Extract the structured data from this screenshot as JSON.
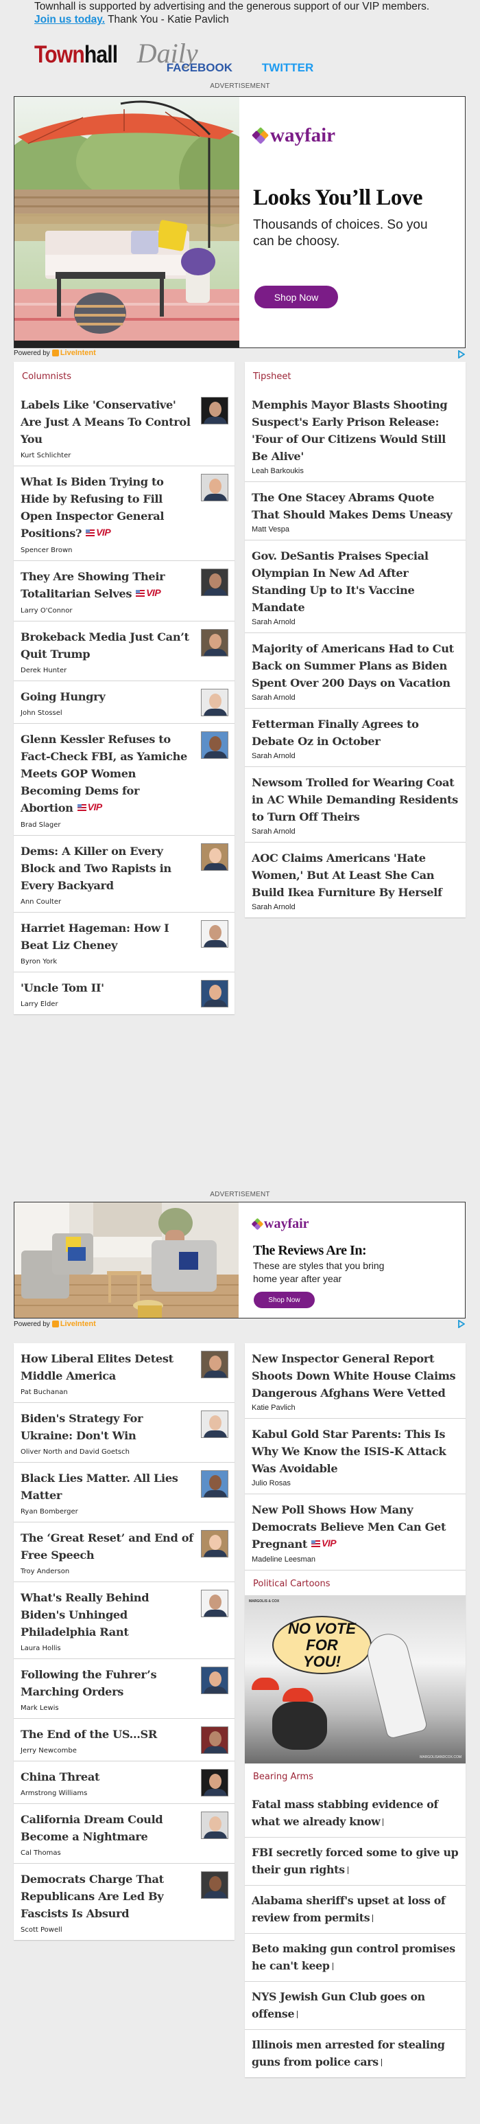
{
  "header": {
    "support_text": "Townhall is supported by advertising and the generous support of our VIP members.",
    "join_link": "Join us today.",
    "thanks_text": " Thank You - Katie Pavlich",
    "logo_town": "Town",
    "logo_hall": "hall",
    "logo_daily": "Daily",
    "social": {
      "facebook": "FACEBOOK",
      "twitter": "TWITTER"
    }
  },
  "ads": [
    {
      "label": "ADVERTISEMENT",
      "brand": "wayfair",
      "headline": "Looks You’ll Love",
      "subtext": "Thousands of choices. So you can be choosy.",
      "cta": "Shop Now",
      "powered_by": "Powered by",
      "powered_brand": "LiveIntent"
    },
    {
      "label": "ADVERTISEMENT",
      "brand": "wayfair",
      "headline": "The Reviews Are In:",
      "subtext": "These are styles that you bring home year after year",
      "cta": "Shop Now",
      "powered_by": "Powered by",
      "powered_brand": "LiveIntent"
    }
  ],
  "vip_label": "VIP",
  "columnists": {
    "title": "Columnists",
    "items": [
      {
        "headline": "Labels Like 'Conservative' Are Just A Means To Control You",
        "author": "Kurt Schlichter",
        "vip": false
      },
      {
        "headline": "What Is Biden Trying to Hide by Refusing to Fill Open Inspector General Positions?",
        "author": "Spencer Brown",
        "vip": true
      },
      {
        "headline": "They Are Showing Their Totalitarian Selves",
        "author": "Larry O'Connor",
        "vip": true
      },
      {
        "headline": "Brokeback Media Just Can’t Quit Trump",
        "author": "Derek Hunter",
        "vip": false
      },
      {
        "headline": "Going Hungry",
        "author": "John Stossel",
        "vip": false
      },
      {
        "headline": "Glenn Kessler Refuses to Fact-Check FBI, as Yamiche Meets GOP Women Becoming Dems for Abortion",
        "author": "Brad Slager",
        "vip": true
      },
      {
        "headline": "Dems: A Killer on Every Block and Two Rapists in Every Backyard",
        "author": "Ann Coulter",
        "vip": false
      },
      {
        "headline": "Harriet Hageman: How I Beat Liz Cheney",
        "author": "Byron York",
        "vip": false
      },
      {
        "headline": "'Uncle Tom II'",
        "author": "Larry Elder",
        "vip": false
      }
    ]
  },
  "tipsheet": {
    "title": "Tipsheet",
    "items": [
      {
        "headline": "Memphis Mayor Blasts Shooting Suspect's Early Prison Release: 'Four of Our Citizens Would Still Be Alive'",
        "author": "Leah Barkoukis"
      },
      {
        "headline": "The One Stacey Abrams Quote That Should Makes Dems Uneasy",
        "author": "Matt Vespa"
      },
      {
        "headline": "Gov. DeSantis Praises Special Olympian In New Ad After Standing Up to It's Vaccine Mandate",
        "author": "Sarah Arnold"
      },
      {
        "headline": "Majority of Americans Had to Cut Back on Summer Plans as Biden Spent Over 200 Days on Vacation",
        "author": "Sarah Arnold"
      },
      {
        "headline": "Fetterman Finally Agrees to Debate Oz in October",
        "author": "Sarah Arnold"
      },
      {
        "headline": "Newsom Trolled for Wearing Coat in AC While Demanding Residents to Turn Off Theirs",
        "author": "Sarah Arnold"
      },
      {
        "headline": "AOC Claims Americans 'Hate Women,' But At Least She Can Build Ikea Furniture By Herself",
        "author": "Sarah Arnold"
      }
    ]
  },
  "columnists2": {
    "items": [
      {
        "headline": "How Liberal Elites Detest Middle America",
        "author": "Pat Buchanan"
      },
      {
        "headline": "Biden's Strategy For Ukraine: Don't Win",
        "author": "Oliver North and David Goetsch"
      },
      {
        "headline": "Black Lies Matter. All Lies Matter",
        "author": "Ryan Bomberger"
      },
      {
        "headline": "The ‘Great Reset’ and End of Free Speech",
        "author": "Troy Anderson"
      },
      {
        "headline": "What's Really Behind Biden's Unhinged Philadelphia Rant",
        "author": "Laura Hollis"
      },
      {
        "headline": "Following the Fuhrer’s Marching Orders",
        "author": "Mark Lewis"
      },
      {
        "headline": "The End of the US...SR",
        "author": "Jerry Newcombe"
      },
      {
        "headline": "China Threat",
        "author": "Armstrong Williams"
      },
      {
        "headline": "California Dream Could Become a Nightmare",
        "author": "Cal Thomas"
      },
      {
        "headline": "Democrats Charge That Republicans Are Led By Fascists Is Absurd",
        "author": "Scott Powell"
      }
    ]
  },
  "tipsheet2": {
    "items": [
      {
        "headline": "New Inspector General Report Shoots Down White House Claims Dangerous Afghans Were Vetted",
        "author": "Katie Pavlich",
        "vip": false
      },
      {
        "headline": "Kabul Gold Star Parents: This Is Why We Know the ISIS-K Attack Was Avoidable",
        "author": "Julio Rosas",
        "vip": false
      },
      {
        "headline": "New Poll Shows How Many Democrats Believe Men Can Get Pregnant",
        "author": "Madeline Leesman",
        "vip": true
      }
    ]
  },
  "cartoons": {
    "title": "Political Cartoons",
    "speech": "NO VOTE FOR YOU!",
    "credit_top": "MARGOLIS & COX",
    "credit_bottom": "MARGOLISANDCOX.COM"
  },
  "bearing_arms": {
    "title": "Bearing Arms",
    "items": [
      {
        "headline": "Fatal mass stabbing evidence of what we already know"
      },
      {
        "headline": "FBI secretly forced some to give up their gun rights"
      },
      {
        "headline": "Alabama sheriff's upset at loss of review from permits"
      },
      {
        "headline": "Beto making gun control promises he can't keep"
      },
      {
        "headline": "NYS Jewish Gun Club goes on offense"
      },
      {
        "headline": "Illinois men arrested for stealing guns from police cars"
      }
    ]
  },
  "colors": {
    "brand_red": "#b3161f",
    "section_title": "#9b2335",
    "wayfair_purple": "#7b1c87",
    "facebook": "#2d59a8",
    "twitter": "#1d9bf0",
    "link_blue": "#1a8fdb",
    "liveintent_orange": "#f7a21b"
  }
}
